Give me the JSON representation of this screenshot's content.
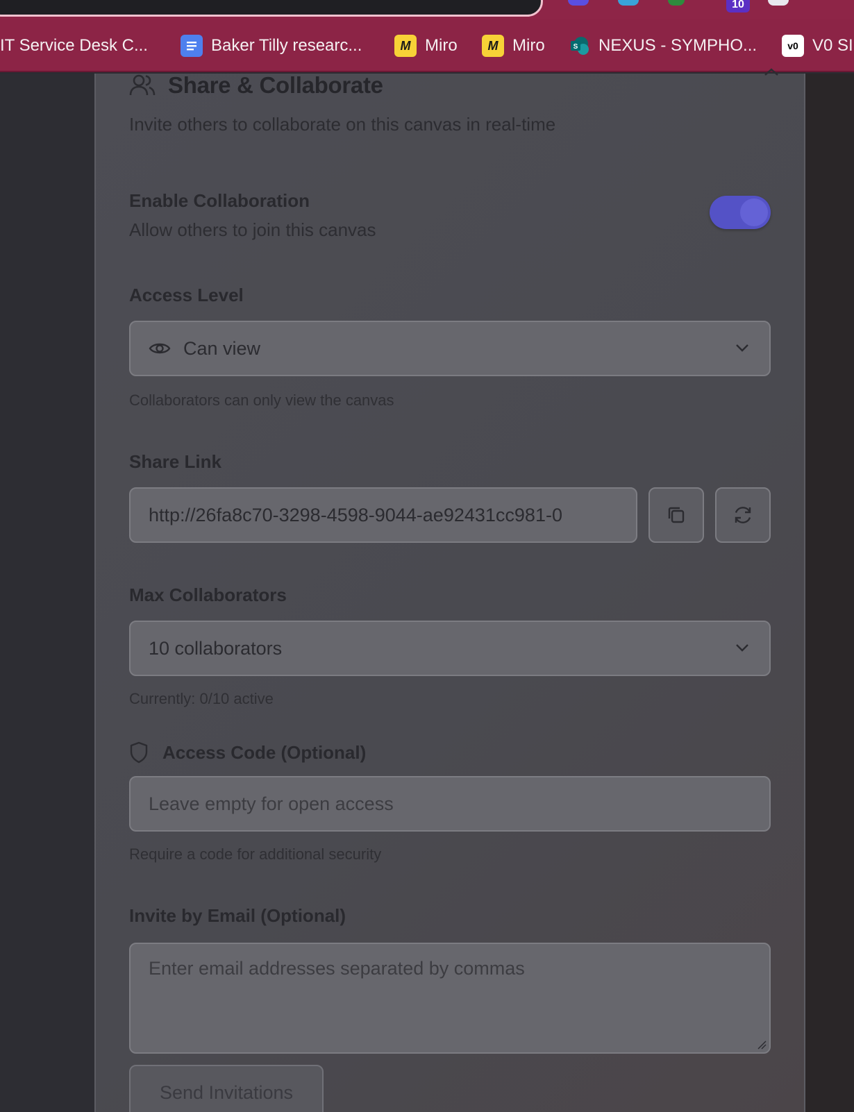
{
  "browser": {
    "omnibox_text": "...",
    "extension_badge": "10",
    "bookmarks": [
      {
        "label": "IT Service Desk C...",
        "icon": "none"
      },
      {
        "label": "Baker Tilly researc...",
        "icon": "google-docs-icon"
      },
      {
        "label": "Miro",
        "icon": "miro-icon"
      },
      {
        "label": "Miro",
        "icon": "miro-icon"
      },
      {
        "label": "NEXUS - SYMPHO...",
        "icon": "sharepoint-icon"
      },
      {
        "label": "V0 SI",
        "icon": "v0-icon"
      }
    ]
  },
  "dialog": {
    "title": "Share & Collaborate",
    "subtitle": "Invite others to collaborate on this canvas in real-time",
    "enable_collaboration": {
      "label": "Enable Collaboration",
      "description": "Allow others to join this canvas",
      "enabled": true
    },
    "access_level": {
      "label": "Access Level",
      "selected": "Can view",
      "hint": "Collaborators can only view the canvas"
    },
    "share_link": {
      "label": "Share Link",
      "value": "http://26fa8c70-3298-4598-9044-ae92431cc981-0"
    },
    "max_collaborators": {
      "label": "Max Collaborators",
      "selected": "10 collaborators",
      "hint": "Currently: 0/10 active"
    },
    "access_code": {
      "label": "Access Code (Optional)",
      "placeholder": "Leave empty for open access",
      "hint": "Require a code for additional security"
    },
    "invite_email": {
      "label": "Invite by Email (Optional)",
      "placeholder": "Enter email addresses separated by commas"
    },
    "send_button": "Send Invitations"
  },
  "colors": {
    "bookmark_bar": "#8c2446",
    "toggle_on": "#5452c6",
    "overlay_panel": "#4d4d54"
  }
}
